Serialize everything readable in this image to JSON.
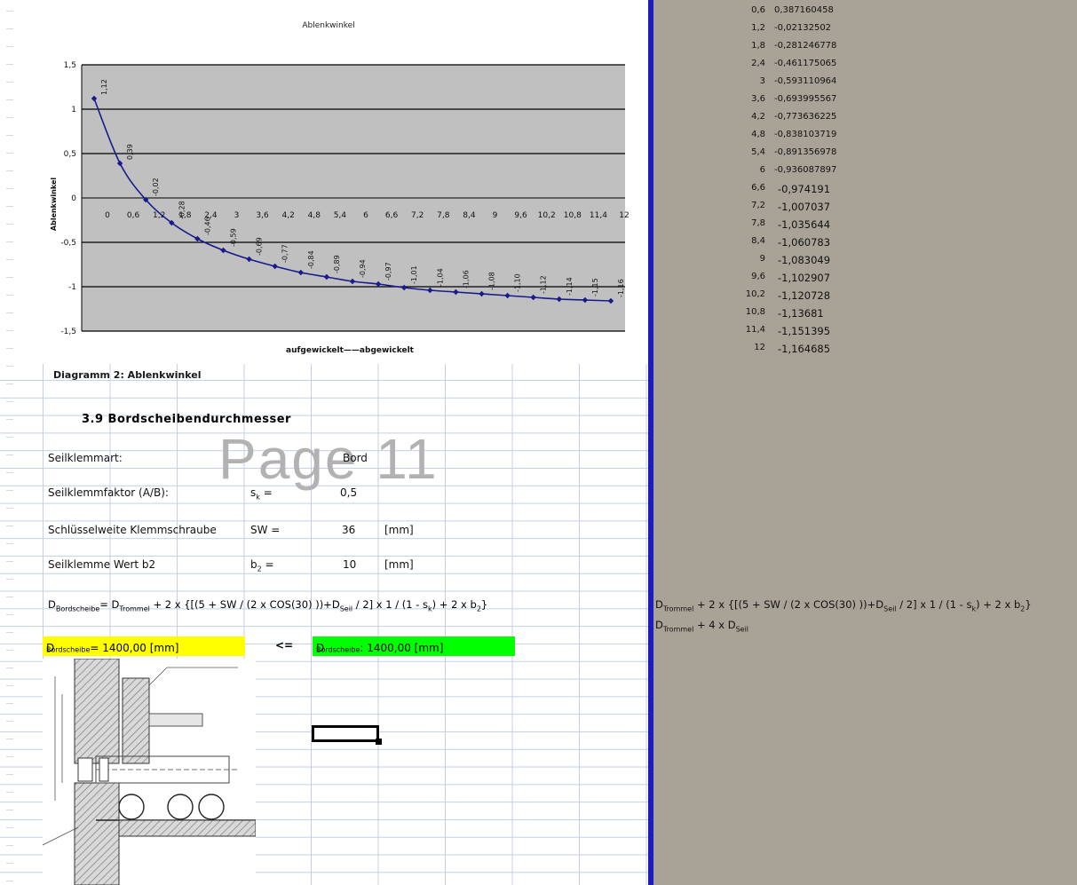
{
  "chart_data": {
    "type": "line",
    "title": "Ablenkwinkel",
    "ylabel": "Ablenkwinkel",
    "legend": "aufgewickelt——abgewickelt",
    "x": [
      "0",
      "0,6",
      "1,2",
      "1,8",
      "2,4",
      "3",
      "3,6",
      "4,2",
      "4,8",
      "5,4",
      "6",
      "6,6",
      "7,2",
      "7,8",
      "8,4",
      "9",
      "9,6",
      "10,2",
      "10,8",
      "11,4",
      "12"
    ],
    "series": [
      {
        "values": [
          1.12,
          0.39,
          -0.02,
          -0.28,
          -0.46,
          -0.59,
          -0.69,
          -0.77,
          -0.84,
          -0.89,
          -0.94,
          -0.97,
          -1.01,
          -1.04,
          -1.06,
          -1.08,
          -1.1,
          -1.12,
          -1.14,
          -1.15,
          -1.16
        ],
        "labels": [
          "1,12",
          "0,39",
          "-0,02",
          "-0,28",
          "-0,46",
          "-0,59",
          "-0,69",
          "-0,77",
          "-0,84",
          "-0,89",
          "-0,94",
          "-0,97",
          "-1,01",
          "-1,04",
          "-1,06",
          "-1,08",
          "-1,10",
          "-1,12",
          "-1,14",
          "-1,15",
          "-1,16"
        ],
        "color": "#1a1a8c"
      }
    ],
    "y_ticks": [
      "1,5",
      "1",
      "0,5",
      "0",
      "-0,5",
      "-1",
      "-1,5"
    ],
    "ylim": [
      -1.5,
      1.5
    ],
    "grid": true,
    "plot_background": "#c0c0c0"
  },
  "caption": "Diagramm 2: Ablenkwinkel",
  "section": {
    "heading": "3.9  Bordscheibendurchmesser",
    "watermark": "Page 11",
    "rows": [
      {
        "label": "Seilklemmart:",
        "symbol": "",
        "value": "Bord",
        "unit": ""
      },
      {
        "label": "Seilklemmfaktor (A/B):",
        "symbol_main": "s",
        "symbol_sub": "k",
        "symbol_tail": " =",
        "value": "0,5",
        "unit": ""
      },
      {
        "label": "Schlüsselweite Klemmschraube",
        "symbol": "SW =",
        "value": "36",
        "unit": "[mm]"
      },
      {
        "label": "Seilklemme Wert b2",
        "symbol_main": "b",
        "symbol_sub": "2",
        "symbol_tail": " =",
        "value": "10",
        "unit": "[mm]"
      }
    ],
    "formula": {
      "lhs_main": "D",
      "lhs_sub": "Bordscheibe",
      "part1": "= D",
      "sub1": "Trommel",
      "part2": " + 2 x {[(5 + SW / (2 x COS(30) ))+D",
      "sub2": "Seil",
      "part3": " / 2] x 1 / (1 - s",
      "sub3": "k",
      "part4": ") + 2 x b",
      "sub4": "2",
      "part5": "}"
    },
    "result_left": {
      "main": "D",
      "sub": "Bordscheibe",
      "text": " =  1400,00   [mm]"
    },
    "compare": "<=",
    "result_right": {
      "main": "D",
      "sub": "Bordscheibe",
      "text": " :  1400,00   [mm]"
    }
  },
  "colors": {
    "yellow_cell": "#ffff00",
    "green_cell": "#00ff00",
    "separator": "#1c1cbe",
    "right_bg": "#a9a397"
  },
  "right_panel": {
    "rows": [
      {
        "x": "0,6",
        "y": "0,387160458"
      },
      {
        "x": "1,2",
        "y": "-0,02132502"
      },
      {
        "x": "1,8",
        "y": "-0,281246778"
      },
      {
        "x": "2,4",
        "y": "-0,461175065"
      },
      {
        "x": "3",
        "y": "-0,593110964"
      },
      {
        "x": "3,6",
        "y": "-0,693995567"
      },
      {
        "x": "4,2",
        "y": "-0,773636225"
      },
      {
        "x": "4,8",
        "y": "-0,838103719"
      },
      {
        "x": "5,4",
        "y": "-0,891356978"
      },
      {
        "x": "6",
        "y": "-0,936087897"
      },
      {
        "x": "6,6",
        "y": "-0,974191"
      },
      {
        "x": "7,2",
        "y": "-1,007037"
      },
      {
        "x": "7,8",
        "y": "-1,035644"
      },
      {
        "x": "8,4",
        "y": "-1,060783"
      },
      {
        "x": "9",
        "y": "-1,083049"
      },
      {
        "x": "9,6",
        "y": "-1,102907"
      },
      {
        "x": "10,2",
        "y": "-1,120728"
      },
      {
        "x": "10,8",
        "y": "-1,13681"
      },
      {
        "x": "11,4",
        "y": "-1,151395"
      },
      {
        "x": "12",
        "y": "-1,164685"
      }
    ],
    "formula1": {
      "part1": "D",
      "sub1": "Trommel",
      "part2": " + 2 x {[(5 + SW / (2 x COS(30) ))+D",
      "sub2": "Seil",
      "part3": " / 2] x 1 / (1 - s",
      "sub3": "k",
      "part4": ") + 2 x b",
      "sub4": "2",
      "part5": "}"
    },
    "formula2": {
      "part1": "D",
      "sub1": "Trommel",
      "part2": " + 4 x D",
      "sub2": "Seil"
    }
  }
}
